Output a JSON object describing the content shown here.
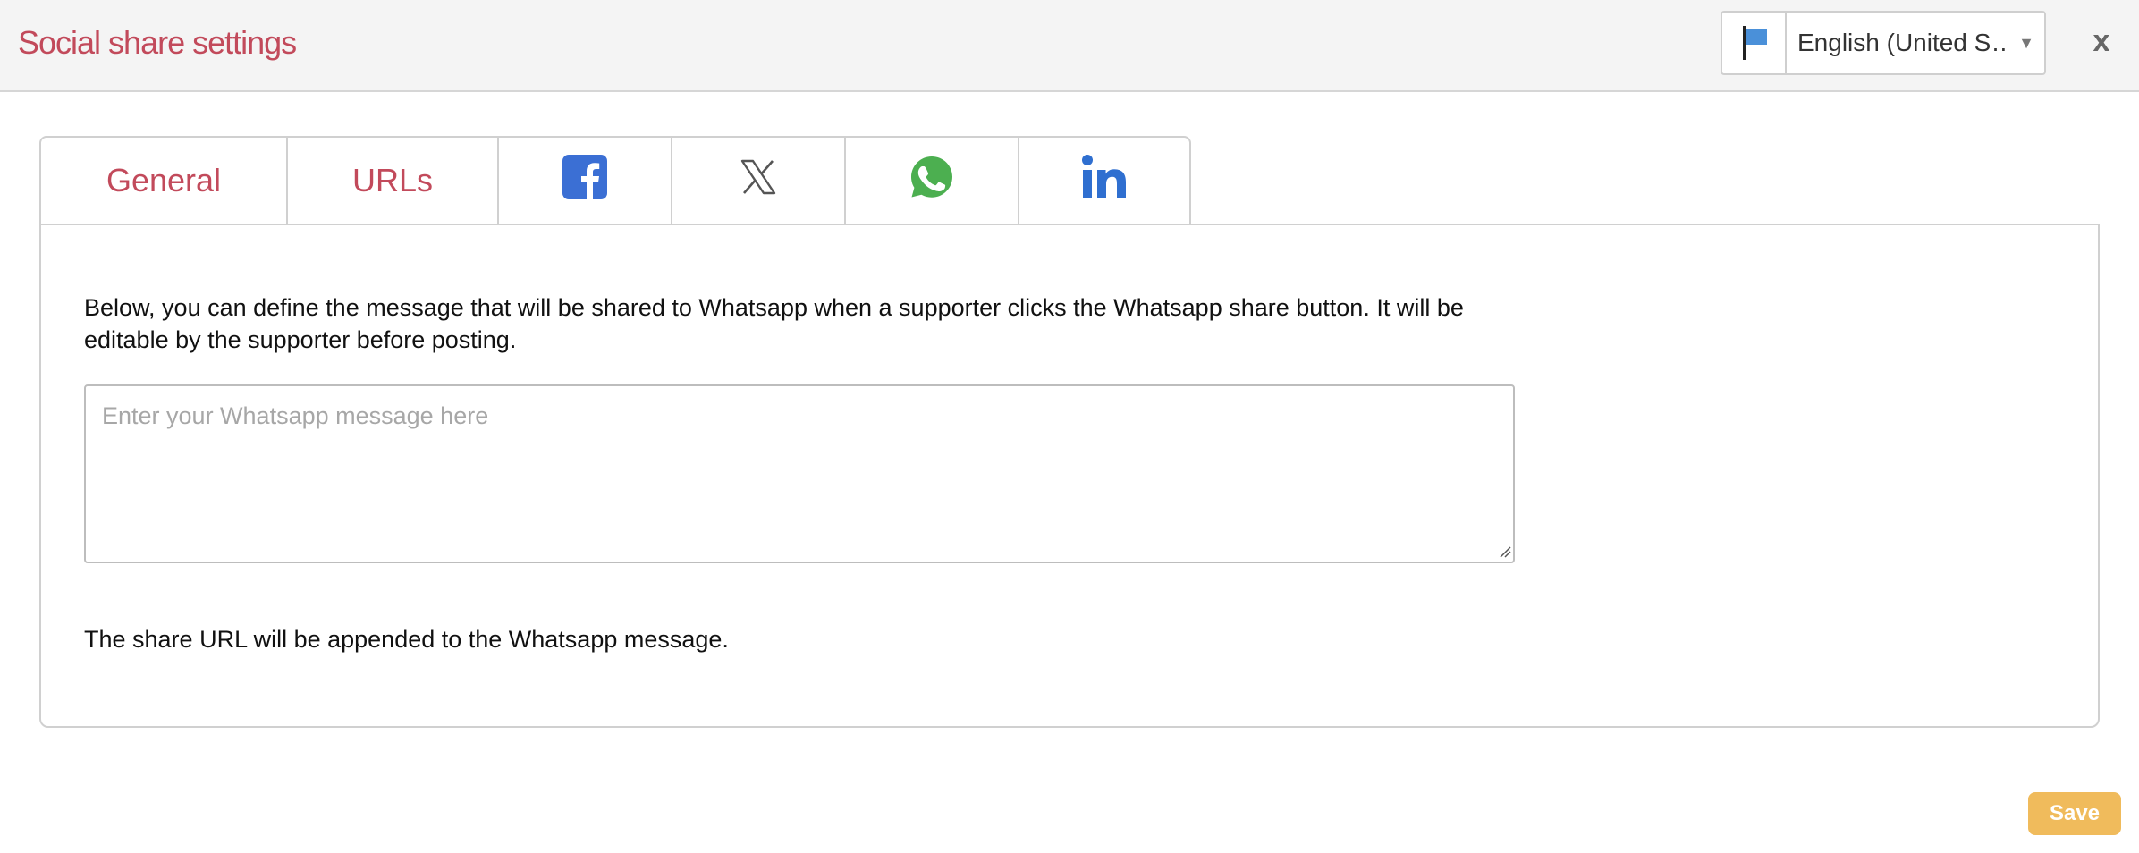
{
  "header": {
    "title": "Social share settings",
    "language": "English (United S…",
    "close_label": "x"
  },
  "tabs": [
    {
      "label": "General",
      "active": false
    },
    {
      "label": "URLs",
      "active": false
    },
    {
      "label": "",
      "icon": "facebook-icon",
      "active": false
    },
    {
      "label": "",
      "icon": "x-twitter-icon",
      "active": false
    },
    {
      "label": "",
      "icon": "whatsapp-icon",
      "active": true
    },
    {
      "label": "",
      "icon": "linkedin-icon",
      "active": false
    }
  ],
  "panel": {
    "description": "Below, you can define the message that will be shared to Whatsapp when a supporter clicks the Whatsapp share button. It will be editable by the supporter before posting.",
    "message_value": "",
    "message_placeholder": "Enter your Whatsapp message here",
    "append_note": "The share URL will be appended to the Whatsapp message."
  },
  "footer": {
    "save_label": "Save"
  },
  "colors": {
    "accent": "#c24a5b",
    "facebook": "#3b6fd4",
    "whatsapp": "#4caf50",
    "linkedin": "#2f6fd0",
    "save": "#f0bb5c"
  }
}
